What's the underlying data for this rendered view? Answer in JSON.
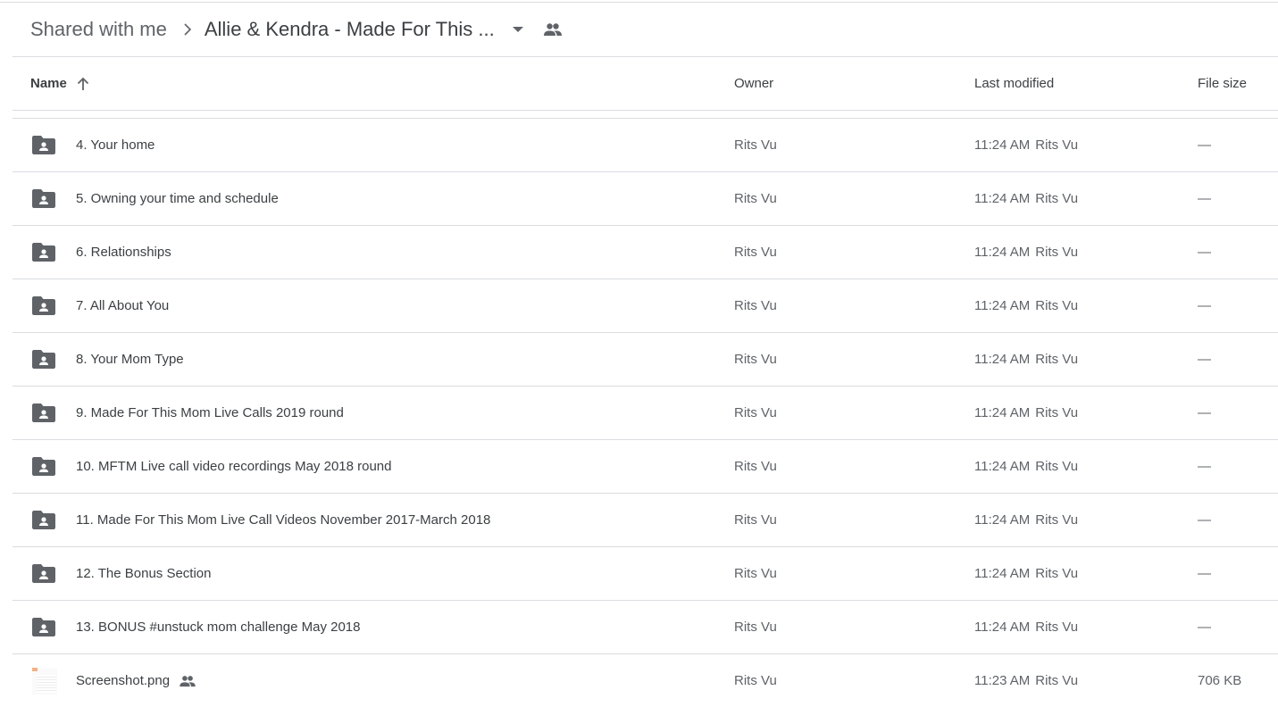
{
  "breadcrumb": {
    "root": "Shared with me",
    "current": "Allie & Kendra - Made For This ...",
    "icons": {
      "separator": "chevron-right-icon",
      "dropdown": "arrow-drop-down-icon",
      "shared": "people-icon"
    }
  },
  "columns": {
    "name": "Name",
    "name_sort": "arrow-upward-icon",
    "owner": "Owner",
    "last_modified": "Last modified",
    "file_size": "File size"
  },
  "colors": {
    "text_primary": "#3c4043",
    "text_secondary": "#5f6368",
    "divider": "#dadce0",
    "folder_icon": "#5f6368"
  },
  "rows": [
    {
      "type": "shared-folder",
      "name": "4. Your home",
      "owner": "Rits Vu",
      "modified": "11:24 AM",
      "modified_by": "Rits Vu",
      "size": "—"
    },
    {
      "type": "shared-folder",
      "name": "5. Owning your time and schedule",
      "owner": "Rits Vu",
      "modified": "11:24 AM",
      "modified_by": "Rits Vu",
      "size": "—"
    },
    {
      "type": "shared-folder",
      "name": "6. Relationships",
      "owner": "Rits Vu",
      "modified": "11:24 AM",
      "modified_by": "Rits Vu",
      "size": "—"
    },
    {
      "type": "shared-folder",
      "name": "7. All About You",
      "owner": "Rits Vu",
      "modified": "11:24 AM",
      "modified_by": "Rits Vu",
      "size": "—"
    },
    {
      "type": "shared-folder",
      "name": "8. Your Mom Type",
      "owner": "Rits Vu",
      "modified": "11:24 AM",
      "modified_by": "Rits Vu",
      "size": "—"
    },
    {
      "type": "shared-folder",
      "name": "9. Made For This Mom Live Calls 2019 round",
      "owner": "Rits Vu",
      "modified": "11:24 AM",
      "modified_by": "Rits Vu",
      "size": "—"
    },
    {
      "type": "shared-folder",
      "name": "10. MFTM Live call video recordings May 2018 round",
      "owner": "Rits Vu",
      "modified": "11:24 AM",
      "modified_by": "Rits Vu",
      "size": "—"
    },
    {
      "type": "shared-folder",
      "name": "11. Made For This Mom Live Call Videos November 2017-March 2018",
      "owner": "Rits Vu",
      "modified": "11:24 AM",
      "modified_by": "Rits Vu",
      "size": "—"
    },
    {
      "type": "shared-folder",
      "name": "12. The Bonus Section",
      "owner": "Rits Vu",
      "modified": "11:24 AM",
      "modified_by": "Rits Vu",
      "size": "—"
    },
    {
      "type": "shared-folder",
      "name": "13. BONUS #unstuck mom challenge May 2018",
      "owner": "Rits Vu",
      "modified": "11:24 AM",
      "modified_by": "Rits Vu",
      "size": "—"
    },
    {
      "type": "image-file",
      "name": "Screenshot.png",
      "shared": true,
      "owner": "Rits Vu",
      "modified": "11:23 AM",
      "modified_by": "Rits Vu",
      "size": "706 KB"
    }
  ]
}
